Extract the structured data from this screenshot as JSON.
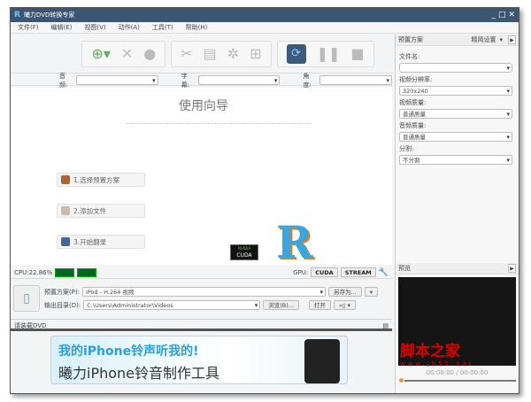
{
  "window": {
    "title": "曦力DVD转换专家",
    "logo": "R"
  },
  "menu": [
    "文件(F)",
    "编辑(E)",
    "视图(V)",
    "动作(A)",
    "工具(T)",
    "帮助(H)"
  ],
  "selectors": {
    "audio": "音频:",
    "subtitle": "字幕:",
    "angle": "角度:"
  },
  "wizard": {
    "title": "使用向导",
    "steps": [
      "1.选择预置方案",
      "2.添加文件",
      "3.开始翻录"
    ],
    "cuda": "CUDA",
    "nvidia": "NVIDIA"
  },
  "status": {
    "cpu": "CPU:22.86%",
    "gpu": "GPU:",
    "cuda": "CUDA",
    "stream": "STREAM"
  },
  "output": {
    "preset_label": "预置方案(P):",
    "preset_value": "iPod - H.264 视频",
    "save_as": "另存为...",
    "dir_label": "输出目录(D):",
    "dir_value": "C:\\Users\\Administrator\\Videos",
    "browse": "浏览(B)...",
    "open": "打开"
  },
  "dvd": {
    "label": "请装载DVD"
  },
  "ad": {
    "line1": "我的iPhone铃声听我的!",
    "line2": "曦力iPhone铃音制作工具"
  },
  "right": {
    "header": "预置方案",
    "advanced": "精简设置",
    "filename_label": "文件名:",
    "filename_value": "",
    "res_label": "视频分辨率:",
    "res_value": "320x240",
    "vq_label": "视频质量:",
    "vq_value": "普通质量",
    "aq_label": "音频质量:",
    "aq_value": "普通质量",
    "split_label": "分割:",
    "split_value": "不分割"
  },
  "preview": {
    "header": "预览",
    "time": "00:00:00 / 00:00:00",
    "watermark": "脚本之家",
    "watermark_url": "www.jb51.net",
    "progress": 0
  }
}
